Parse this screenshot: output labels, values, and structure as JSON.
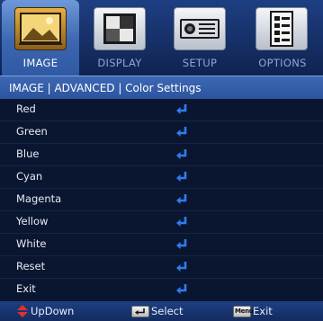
{
  "tabs": [
    {
      "label": "IMAGE",
      "icon": "image-icon",
      "active": true
    },
    {
      "label": "DISPLAY",
      "icon": "display-icon",
      "active": false
    },
    {
      "label": "SETUP",
      "icon": "projector-icon",
      "active": false
    },
    {
      "label": "OPTIONS",
      "icon": "options-icon",
      "active": false
    }
  ],
  "breadcrumb": "IMAGE | ADVANCED | Color Settings",
  "items": [
    {
      "label": "Red"
    },
    {
      "label": "Green"
    },
    {
      "label": "Blue"
    },
    {
      "label": "Cyan"
    },
    {
      "label": "Magenta"
    },
    {
      "label": "Yellow"
    },
    {
      "label": "White"
    },
    {
      "label": "Reset"
    },
    {
      "label": "Exit"
    }
  ],
  "footer": {
    "updown_label": "UpDown",
    "select_label": "Select",
    "menu_key_label": "Menu",
    "exit_label": "Exit"
  },
  "colors": {
    "accent": "#3c66b0",
    "enter_icon": "#2f7cf0",
    "updown_icon": "#e03030"
  }
}
